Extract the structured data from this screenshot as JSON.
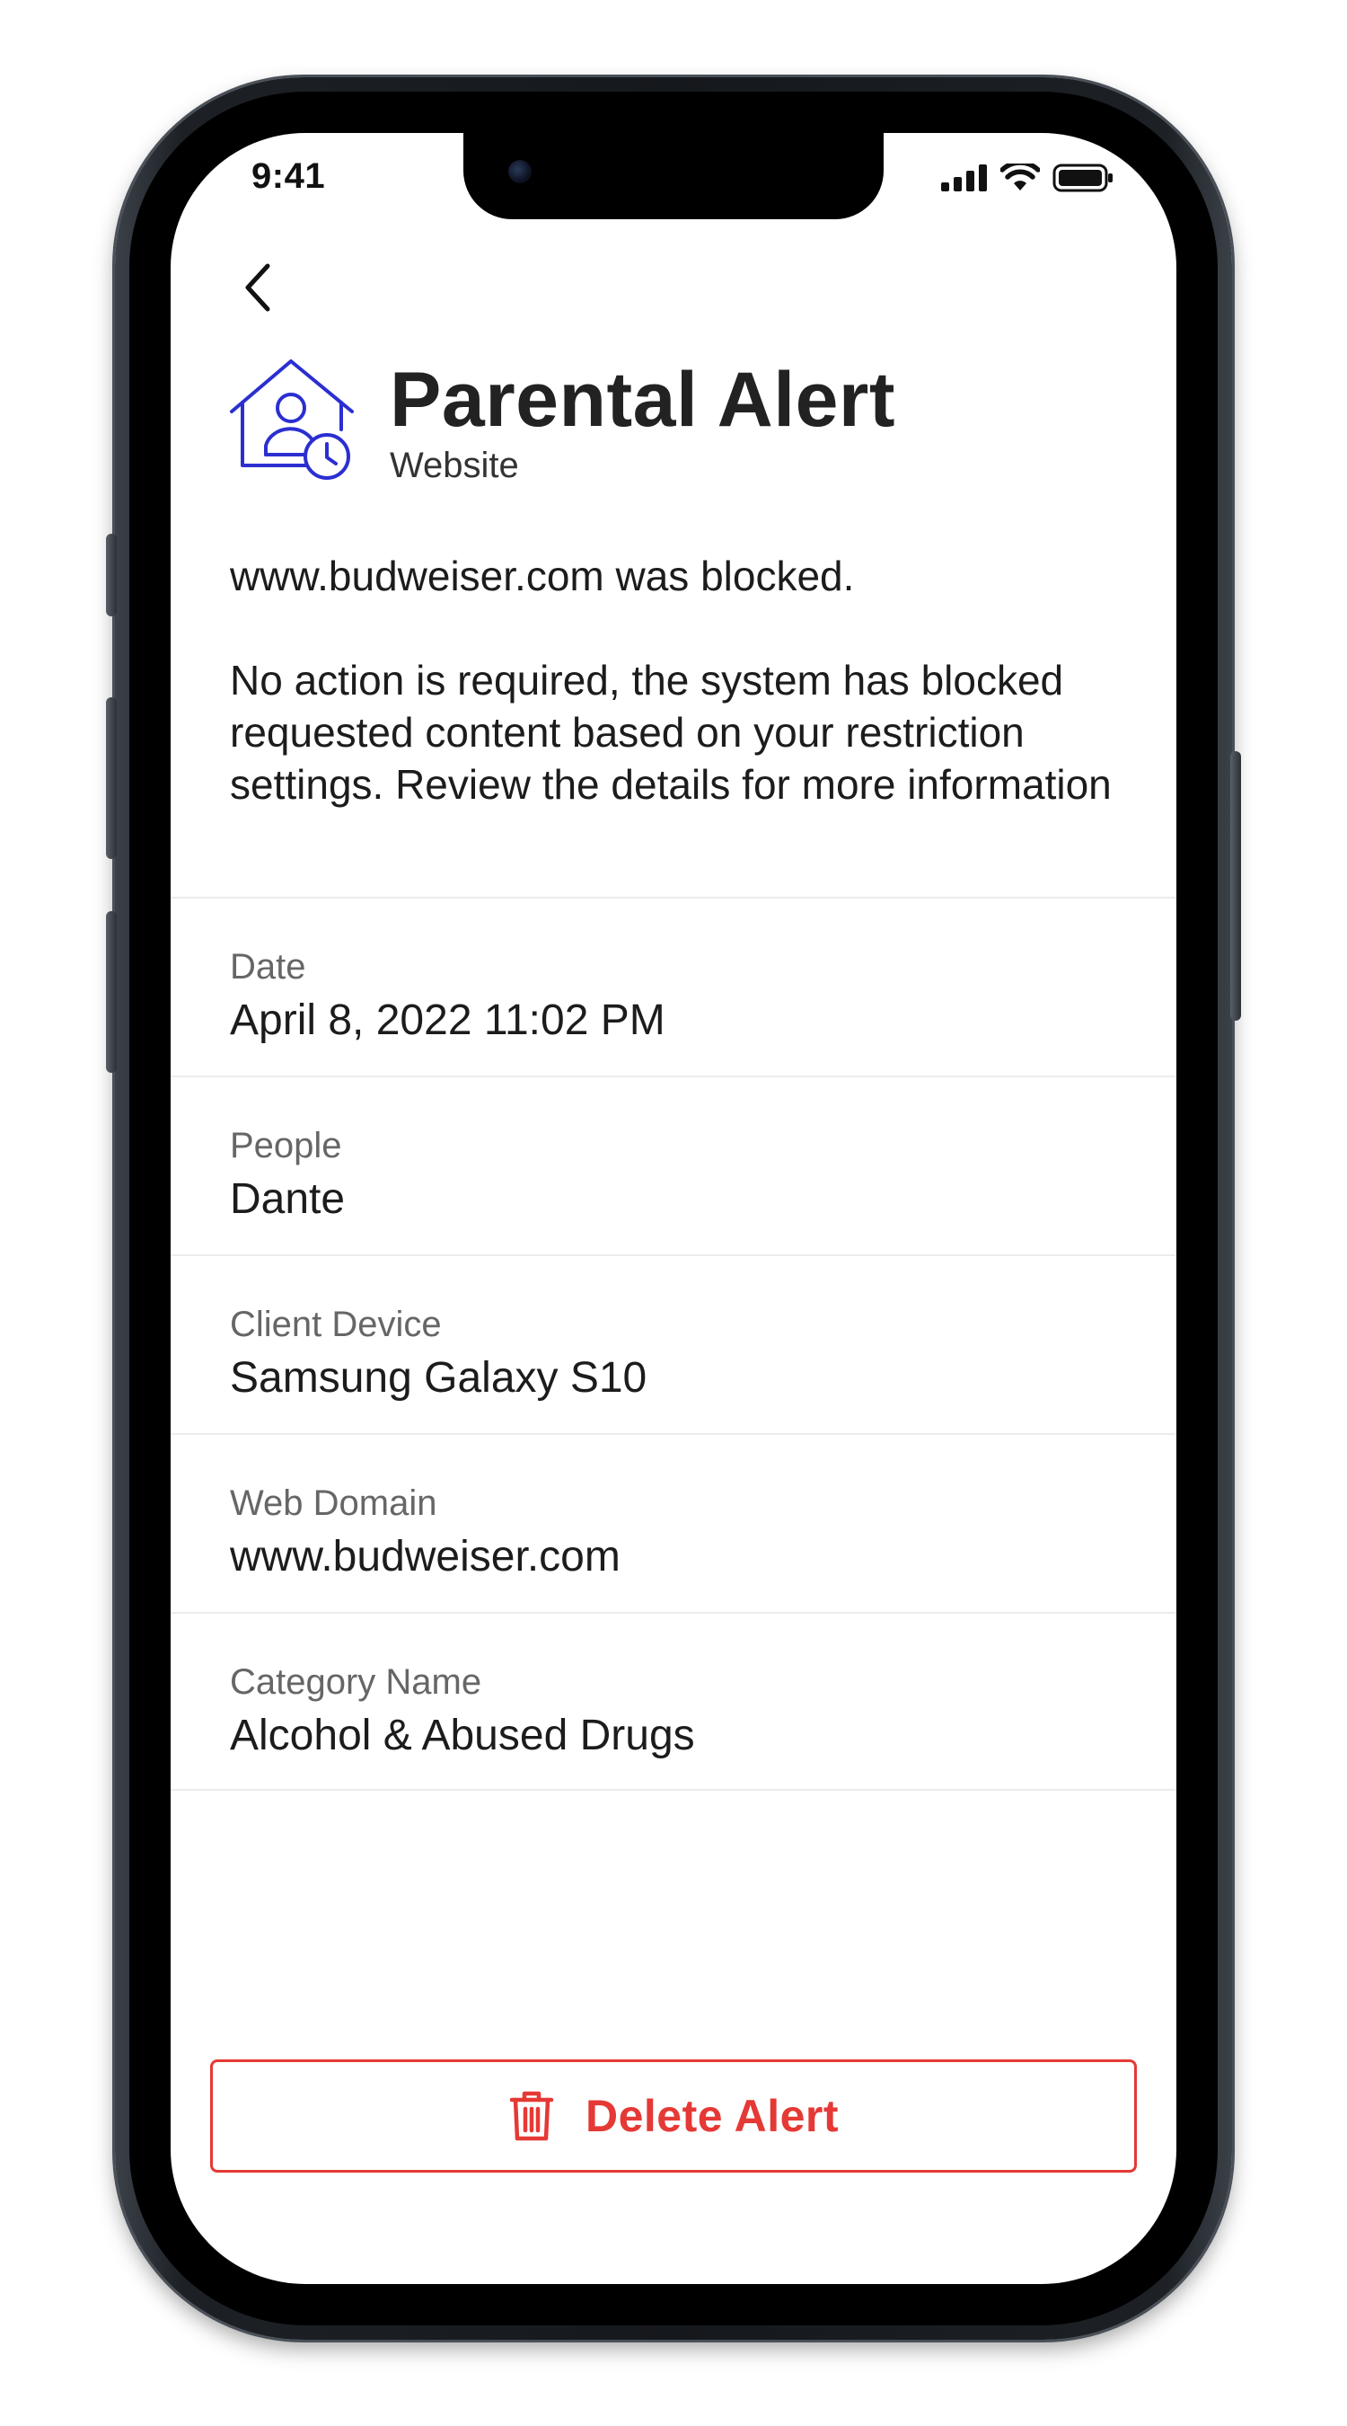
{
  "status_bar": {
    "time": "9:41",
    "icons": [
      "cellular-signal-icon",
      "wifi-icon",
      "battery-icon"
    ]
  },
  "nav": {
    "back_icon": "chevron-left-icon"
  },
  "header": {
    "icon": "house-person-clock-icon",
    "title": "Parental Alert",
    "subtitle": "Website"
  },
  "message": {
    "line1": "www.budweiser.com was blocked.",
    "line2": "No action is required, the system has blocked requested content based on your restriction settings. Review the details for more information"
  },
  "details": [
    {
      "label": "Date",
      "value": "April 8, 2022 11:02 PM"
    },
    {
      "label": "People",
      "value": "Dante"
    },
    {
      "label": "Client Device",
      "value": "Samsung Galaxy S10"
    },
    {
      "label": "Web Domain",
      "value": "www.budweiser.com"
    },
    {
      "label": "Category Name",
      "value": "Alcohol & Abused Drugs"
    }
  ],
  "actions": {
    "delete_label": "Delete Alert",
    "delete_icon": "trash-icon"
  },
  "colors": {
    "accent_blue": "#2b2fd1",
    "danger_red": "#e53935"
  }
}
